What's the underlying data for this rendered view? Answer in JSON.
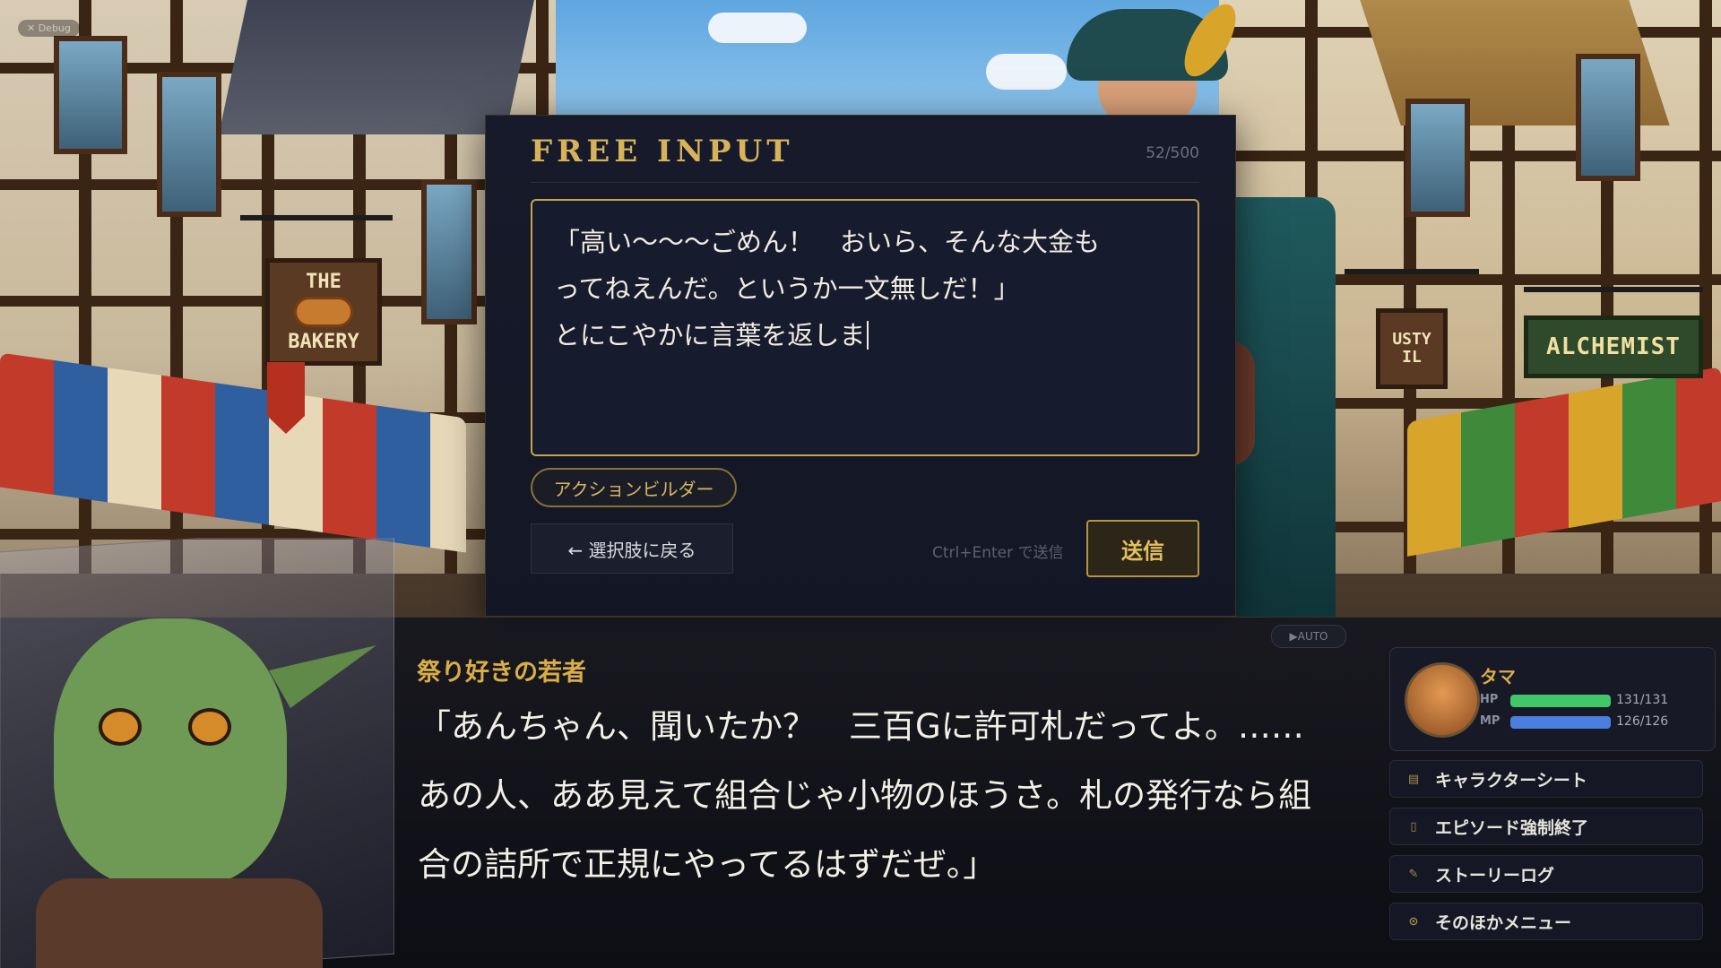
{
  "debug": {
    "label": "✕ Debug"
  },
  "scene": {
    "bakery_sign": {
      "line1": "THE",
      "line2": "BAKERY"
    },
    "alchemist_sign": "ALCHEMIST",
    "rusty_sign": "USTY\nIL"
  },
  "free_input": {
    "title": "FREE INPUT",
    "counter": "52/500",
    "text": "「高い〜〜〜ごめん！　おいら、そんな大金も\nってねえんだ。というか一文無しだ！」\nとにこやかに言葉を返しま",
    "action_builder_label": "アクションビルダー",
    "back_label": "← 選択肢に戻る",
    "send_hint": "Ctrl+Enter で送信",
    "send_label": "送信"
  },
  "dialogue": {
    "auto_label": "▶AUTO",
    "speaker": "祭り好きの若者",
    "lines": [
      "「あんちゃん、聞いたか？　三百Gに許可札だってよ。……",
      "あの人、ああ見えて組合じゃ小物のほうさ。札の発行なら組",
      "合の詰所で正規にやってるはずだぜ。」"
    ]
  },
  "status": {
    "name": "タマ",
    "hp_label": "HP",
    "hp_value": "131/131",
    "hp_fraction": 1.0,
    "mp_label": "MP",
    "mp_value": "126/126",
    "mp_fraction": 1.0,
    "hp_color": "#3fc76a",
    "mp_color": "#4a7fe0"
  },
  "menu": [
    {
      "label": "キャラクターシート",
      "icon": "character-sheet-icon"
    },
    {
      "label": "エピソード強制終了",
      "icon": "end-episode-icon"
    },
    {
      "label": "ストーリーログ",
      "icon": "quill-icon"
    },
    {
      "label": "そのほかメニュー",
      "icon": "pin-icon"
    }
  ],
  "colors": {
    "accent_gold": "#d7b25a",
    "panel": "#141828"
  }
}
